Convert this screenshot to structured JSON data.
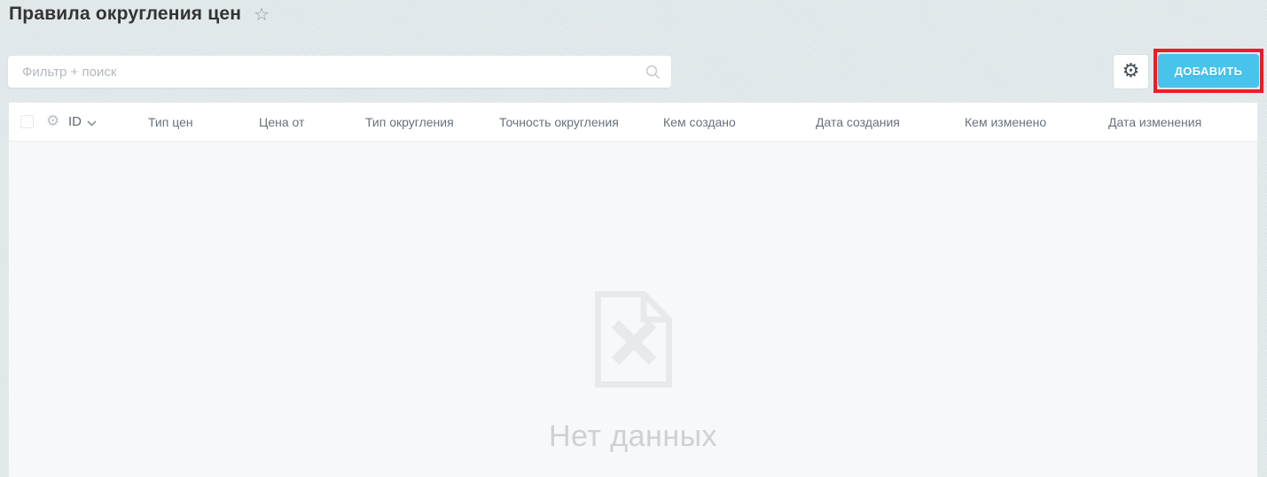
{
  "page": {
    "title": "Правила округления цен",
    "favorite_icon": "star-outline"
  },
  "toolbar": {
    "search": {
      "placeholder": "Фильтр + поиск",
      "value": ""
    },
    "settings_icon": "gear",
    "add_button": {
      "label": "ДОБАВИТЬ"
    }
  },
  "table": {
    "columns": [
      "ID",
      "Тип цен",
      "Цена от",
      "Тип округления",
      "Точность округления",
      "Кем создано",
      "Дата создания",
      "Кем изменено",
      "Дата изменения"
    ],
    "sort": {
      "column": "ID",
      "direction": "desc"
    },
    "rows": [],
    "empty_state": {
      "icon": "document-x",
      "text": "Нет данных"
    }
  },
  "icons": {
    "favorite": "star-outline-icon",
    "search": "search-icon",
    "settings": "gear-icon",
    "column_settings": "gear-icon",
    "sort": "chevron-down-icon",
    "empty": "document-x-icon"
  },
  "colors": {
    "accent_button": "#47c3ec",
    "annotation_box": "#ed1c24",
    "page_background": "#e1e8ea",
    "table_header_background": "#ffffff",
    "table_body_background": "#f7f8f9",
    "header_text": "#68717c",
    "empty_text": "#ccd1d6"
  },
  "annotation": {
    "type": "highlight-box",
    "target": "add-button"
  }
}
